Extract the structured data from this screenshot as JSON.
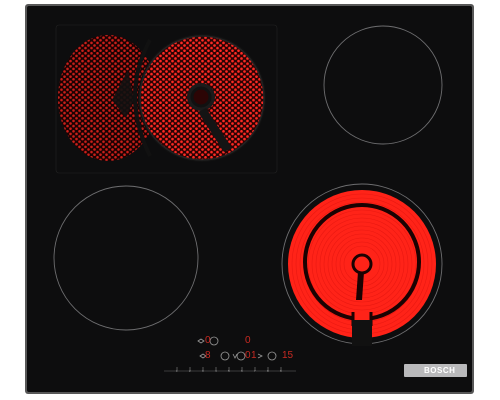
{
  "product": {
    "brand": "BOSCH",
    "type": "Ceramic glass cooktop with four zones"
  },
  "zones": [
    {
      "name": "rear-left zone",
      "shape": "dual oval (extendable)",
      "state": "on",
      "glow_color": "#ff2020"
    },
    {
      "name": "rear-right zone",
      "shape": "round",
      "state": "off"
    },
    {
      "name": "front-left zone",
      "shape": "round",
      "state": "off"
    },
    {
      "name": "front-right zone",
      "shape": "dual round (extendable)",
      "state": "on",
      "glow_color": "#ff1a1a"
    }
  ],
  "control_panel": {
    "row1": [
      "0",
      "0"
    ],
    "row2": [
      "8",
      "0",
      "1",
      "15"
    ],
    "scale": [
      "1",
      "2",
      "3",
      "4",
      "5",
      "6",
      "7",
      "8",
      "9"
    ]
  },
  "colors": {
    "glass": "#0d0d0e",
    "frame": "#585858",
    "zone_outline": "#6e6e70",
    "heat_red": "#ff2020",
    "display_red": "#c72a22",
    "badge": "#b9b9bb"
  }
}
